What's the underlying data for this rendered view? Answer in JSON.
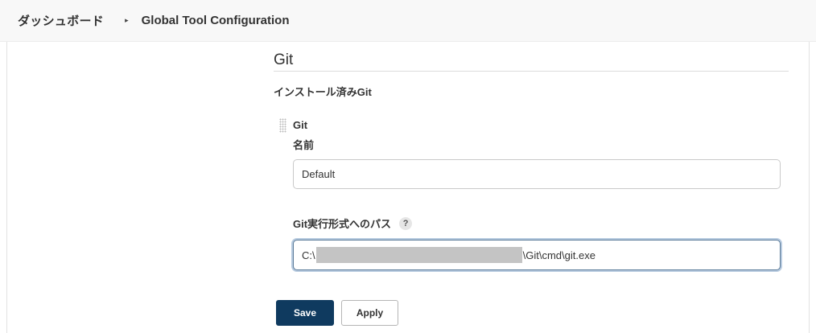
{
  "breadcrumb": {
    "home": "ダッシュボード",
    "separator": "▸",
    "current": "Global Tool Configuration"
  },
  "section": {
    "title": "Git",
    "subheading": "インストール済みGit"
  },
  "git_installation": {
    "title": "Git",
    "name_label": "名前",
    "name_value": "Default",
    "path_label": "Git実行形式へのパス",
    "help_icon": "?",
    "path_prefix": "C:\\",
    "path_suffix": "\\Git\\cmd\\git.exe"
  },
  "buttons": {
    "save": "Save",
    "apply": "Apply"
  },
  "colors": {
    "save_bg": "#0f3a5f",
    "focus_ring": "#b8cbe0",
    "breadcrumb_bg": "#f8f8f8"
  }
}
